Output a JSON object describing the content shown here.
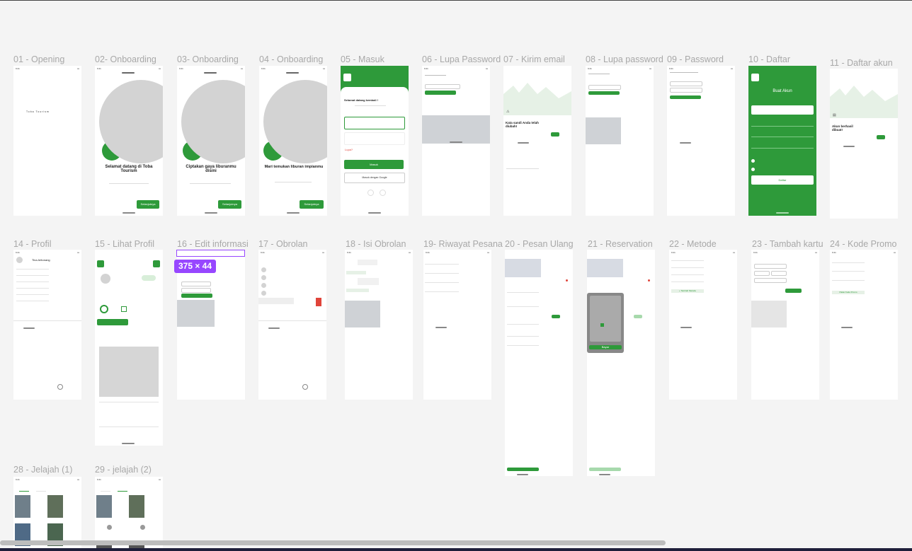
{
  "canvas": {
    "frames": [
      {
        "id": "f01",
        "label": "01 - Opening"
      },
      {
        "id": "f02",
        "label": "02- Onboarding"
      },
      {
        "id": "f03",
        "label": "03- Onboarding"
      },
      {
        "id": "f04",
        "label": "04 - Onboarding"
      },
      {
        "id": "f05",
        "label": "05 - Masuk"
      },
      {
        "id": "f06",
        "label": "06 - Lupa Password"
      },
      {
        "id": "f07",
        "label": "07 - Kirim email"
      },
      {
        "id": "f08",
        "label": "08 - Lupa password"
      },
      {
        "id": "f09",
        "label": "09 -  Password"
      },
      {
        "id": "f10",
        "label": "10 - Daftar"
      },
      {
        "id": "f11",
        "label": "11 - Daftar akun"
      },
      {
        "id": "f14",
        "label": "14 - Profil"
      },
      {
        "id": "f15",
        "label": "15 - Lihat Profil"
      },
      {
        "id": "f16",
        "label": "16 - Edit informasi"
      },
      {
        "id": "f17",
        "label": "17 - Obrolan"
      },
      {
        "id": "f18",
        "label": "18 - Isi Obrolan"
      },
      {
        "id": "f19",
        "label": "19- Riwayat Pesanan"
      },
      {
        "id": "f20",
        "label": "20 - Pesan Ulang"
      },
      {
        "id": "f21",
        "label": "21 - Reservation"
      },
      {
        "id": "f22",
        "label": "22 - Metode"
      },
      {
        "id": "f23",
        "label": "23 - Tambah kartu"
      },
      {
        "id": "f24",
        "label": "24 - Kode Promo"
      },
      {
        "id": "f28",
        "label": "28 - Jelajah (1)"
      },
      {
        "id": "f29",
        "label": "29 - jelajah (2)"
      }
    ],
    "selection_size": "375 × 44"
  },
  "screens": {
    "opening": {
      "brand": "Toba Tourism"
    },
    "onb2": {
      "title": "Selamat datang di Toba Tourism",
      "cta": "Selanjutnya"
    },
    "onb3": {
      "title": "Ciptakan gaya liburanmu disini",
      "cta": "Selanjutnya"
    },
    "onb4": {
      "title": "Mari temukan liburan impianmu",
      "cta": "Selanjutnya"
    },
    "masuk": {
      "greeting": "Selamat datang kembali !",
      "login": "Masuk",
      "google": "Masuk dengan Google",
      "forgot": "Lupa?"
    },
    "kirim": {
      "title": "Kata sandi Anda telah diubah!"
    },
    "daftar": {
      "title": "Buat Akun",
      "cta": "Daftar"
    },
    "daftar_akun": {
      "title": "Akun berhasil dibuat!"
    },
    "profil": {
      "name": "Tina Aritonang"
    },
    "metode": {
      "cta": "+ Tambah Metode"
    },
    "kode_promo": {
      "cta": "Pakai Kode Promo"
    },
    "reservation": {
      "cta": "Bayar"
    }
  },
  "colors": {
    "accent": "#2e9a3a",
    "canvas": "#f4f4f4",
    "selection": "#9747ff"
  }
}
